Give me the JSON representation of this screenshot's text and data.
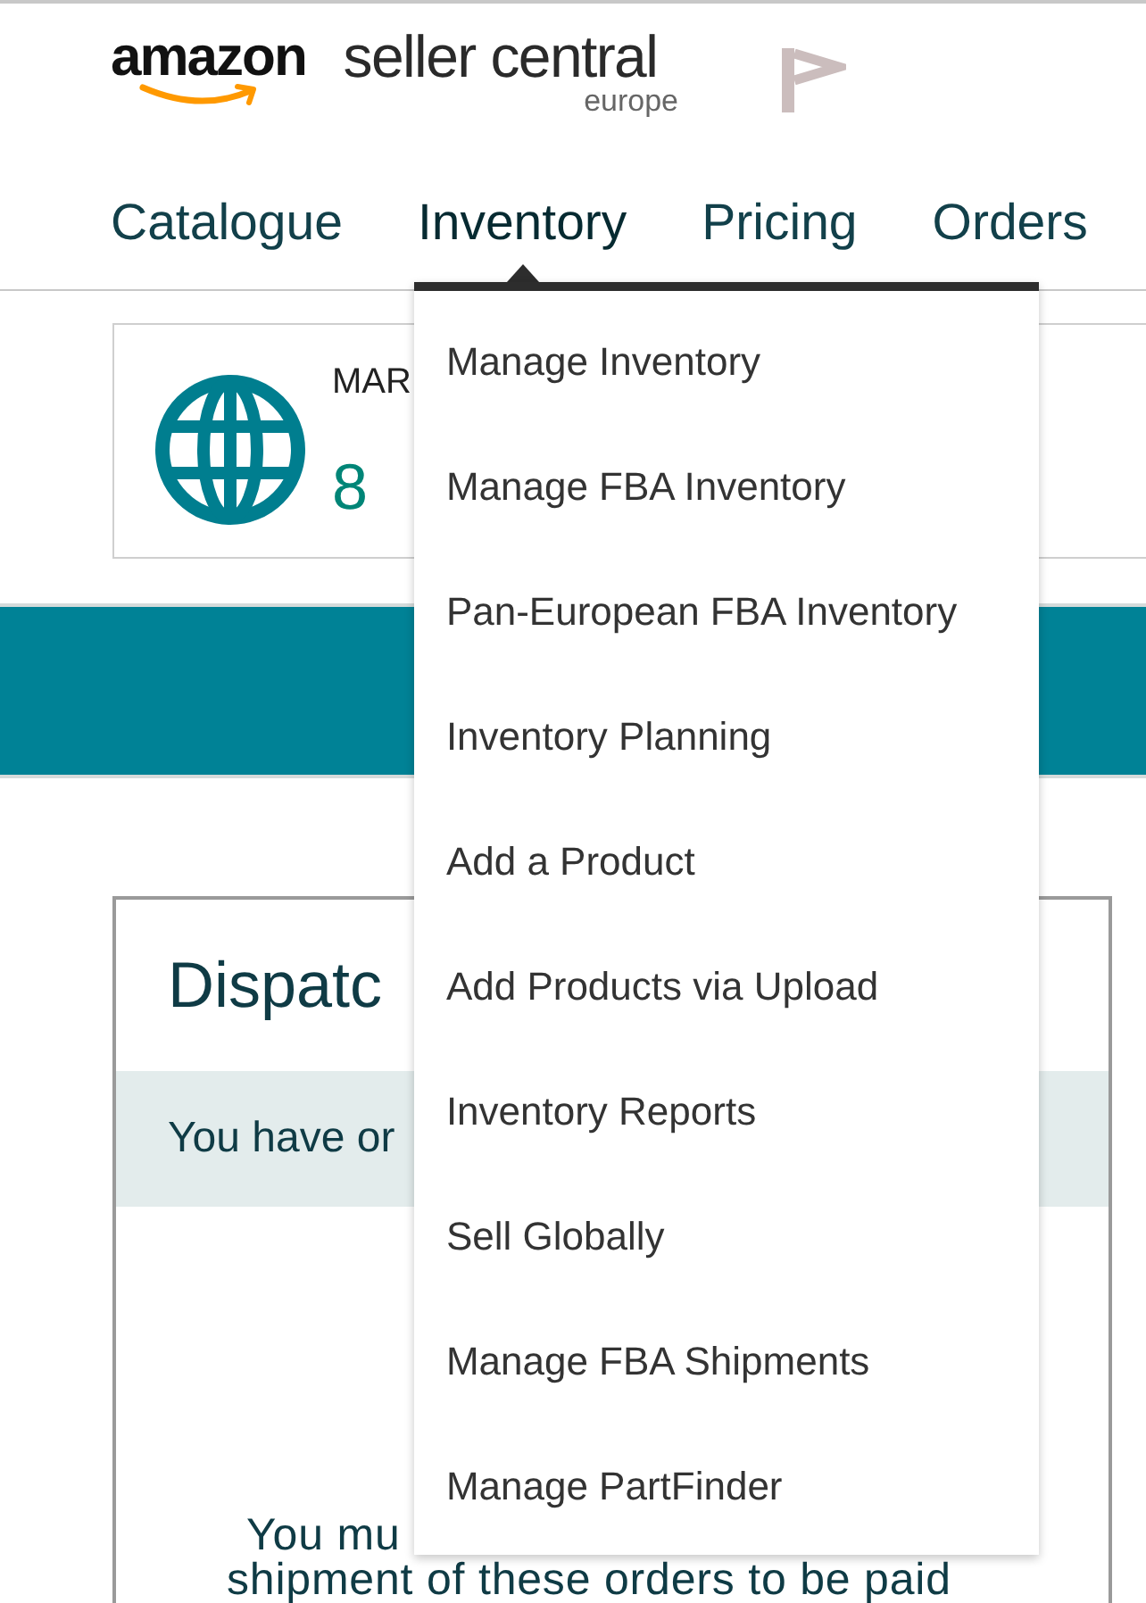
{
  "header": {
    "logo": {
      "brand": "amazon",
      "product": "seller central",
      "region": "europe"
    }
  },
  "nav": {
    "tabs": [
      {
        "label": "Catalogue",
        "selected": false
      },
      {
        "label": "Inventory",
        "selected": true
      },
      {
        "label": "Pricing",
        "selected": false
      },
      {
        "label": "Orders",
        "selected": false
      }
    ],
    "dropdown": {
      "items": [
        "Manage Inventory",
        "Manage FBA Inventory",
        "Pan-European FBA Inventory",
        "Inventory Planning",
        "Add a Product",
        "Add Products via Upload",
        "Inventory Reports",
        "Sell Globally",
        "Manage FBA Shipments",
        "Manage PartFinder"
      ]
    }
  },
  "summary_card": {
    "label": "MAR",
    "value": "8"
  },
  "dispatch_card": {
    "title": "Dispatc",
    "notice": "You have or",
    "message_lines": [
      "You mu",
      "shipment of these orders to be paid"
    ]
  }
}
